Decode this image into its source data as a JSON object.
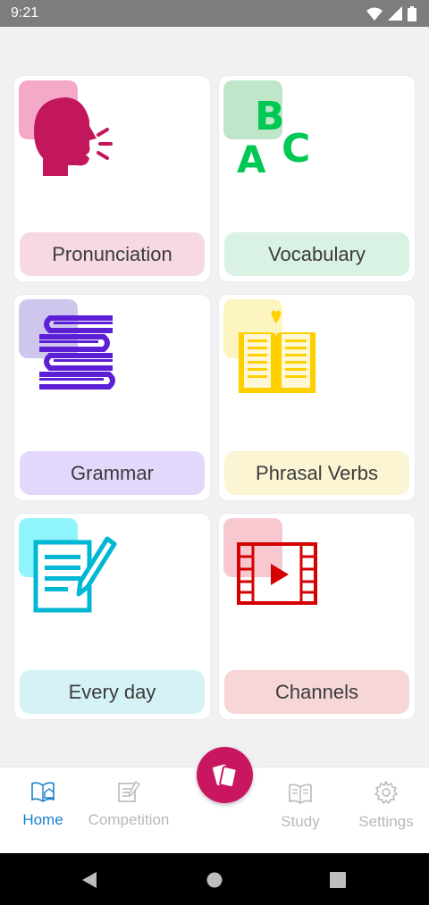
{
  "status_bar": {
    "time": "9:21"
  },
  "categories": [
    {
      "label": "Pronunciation",
      "icon": "speaking-head-icon",
      "tint": "#f5a9c8",
      "label_bg": "#f6d9e4",
      "color": "#c2185b"
    },
    {
      "label": "Vocabulary",
      "icon": "abc-letters-icon",
      "tint": "#bfe6c9",
      "label_bg": "#d9f2e4",
      "color": "#00c853"
    },
    {
      "label": "Grammar",
      "icon": "stacked-books-icon",
      "tint": "#cfc6ee",
      "label_bg": "#e3d8fb",
      "color": "#5c1fd6"
    },
    {
      "label": "Phrasal Verbs",
      "icon": "open-book-heart-icon",
      "tint": "#fdf5bf",
      "label_bg": "#fbf5d3",
      "color": "#ffd000"
    },
    {
      "label": "Every day",
      "icon": "notepad-pencil-icon",
      "tint": "#8ff4fb",
      "label_bg": "#d5f2f6",
      "color": "#00b7d4"
    },
    {
      "label": "Channels",
      "icon": "film-play-icon",
      "tint": "#f7c8d0",
      "label_bg": "#f6d6d6",
      "color": "#d50000"
    }
  ],
  "bottom_nav": {
    "items": [
      {
        "label": "Home",
        "icon": "home-book-icon",
        "active": true
      },
      {
        "label": "Competition",
        "icon": "pencil-document-icon",
        "active": false
      },
      {
        "label": "Study",
        "icon": "reading-book-icon",
        "active": false
      },
      {
        "label": "Settings",
        "icon": "gear-icon",
        "active": false
      }
    ],
    "fab_icon": "flashcards-icon"
  },
  "colors": {
    "accent": "#c91660",
    "active_nav": "#1a7fc9"
  }
}
